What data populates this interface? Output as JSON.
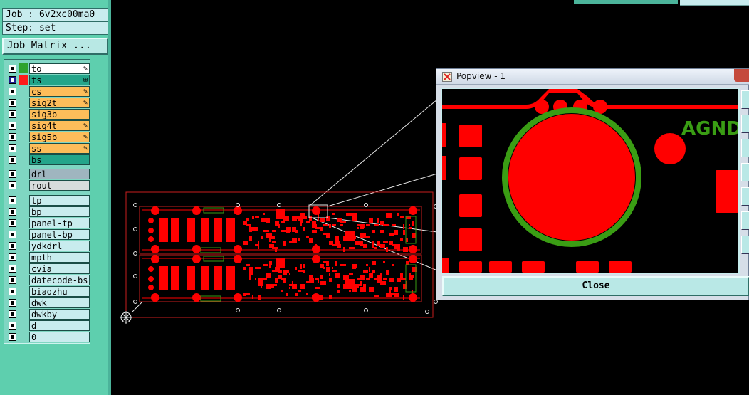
{
  "job": {
    "line": "Job : 6v2xc00ma0"
  },
  "step": {
    "line": "Step: set"
  },
  "job_matrix": {
    "label": "Job Matrix ..."
  },
  "layers_board": [
    {
      "name": "to",
      "bg": "white",
      "swatch": "#2ea32e",
      "checked": false,
      "mark": "✎"
    },
    {
      "name": "ts",
      "bg": "green",
      "swatch": "#ff1a1a",
      "checked": true,
      "mark": "⊞"
    },
    {
      "name": "cs",
      "bg": "orange",
      "swatch": "",
      "checked": false,
      "mark": "✎"
    },
    {
      "name": "sig2t",
      "bg": "orange",
      "swatch": "",
      "checked": false,
      "mark": "✎"
    },
    {
      "name": "sig3b",
      "bg": "orange",
      "swatch": "",
      "checked": false,
      "mark": ""
    },
    {
      "name": "sig4t",
      "bg": "orange",
      "swatch": "",
      "checked": false,
      "mark": "✎"
    },
    {
      "name": "sig5b",
      "bg": "orange",
      "swatch": "",
      "checked": false,
      "mark": "✎"
    },
    {
      "name": "ss",
      "bg": "orange",
      "swatch": "",
      "checked": false,
      "mark": "✎"
    },
    {
      "name": "bs",
      "bg": "green",
      "swatch": "",
      "checked": false,
      "mark": ""
    }
  ],
  "layers_drill": [
    {
      "name": "drl",
      "bg": "greyblue",
      "checked": false
    },
    {
      "name": "rout",
      "bg": "grey",
      "checked": false
    }
  ],
  "layers_misc": [
    {
      "name": "tp",
      "checked": false
    },
    {
      "name": "bp",
      "checked": false
    },
    {
      "name": "panel-tp",
      "checked": false
    },
    {
      "name": "panel-bp",
      "checked": false
    },
    {
      "name": "ydkdrl",
      "checked": false
    },
    {
      "name": "mpth",
      "checked": false
    },
    {
      "name": "cvia",
      "checked": false
    },
    {
      "name": "datecode-bs",
      "checked": false
    },
    {
      "name": "biaozhu",
      "checked": false
    },
    {
      "name": "dwk",
      "checked": false
    },
    {
      "name": "dwkby",
      "checked": false
    },
    {
      "name": "d",
      "checked": false
    },
    {
      "name": "0",
      "checked": false
    }
  ],
  "popview": {
    "title": "Popview - 1",
    "close_label": "Close",
    "agnd_label": "AGND"
  },
  "colors": {
    "panel": "#5ecfae",
    "copper": "#ff0000",
    "mask": "#2ea32e",
    "outline": "#c91e1e"
  },
  "icons": {
    "popview": "popview-app-icon",
    "origin": "origin-crosshair-icon"
  }
}
